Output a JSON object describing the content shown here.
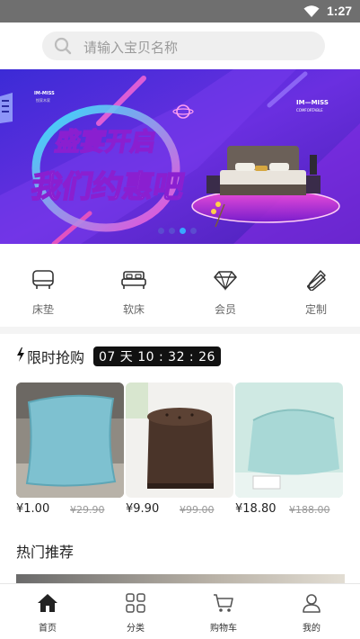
{
  "status_bar": {
    "time": "1:27",
    "icons": [
      "wifi-icon",
      "battery-icon"
    ]
  },
  "search": {
    "placeholder": "请输入宝贝名称",
    "icon": "search-icon"
  },
  "banner": {
    "headline_1": "盛宴开启",
    "headline_2": "我们约惠吧",
    "brand_left": "IM-MISS",
    "brand_left_sub": "悦家木家",
    "brand_right": "IM—MISS",
    "brand_right_sub": "COMFORTABLE",
    "pager_count": 4,
    "pager_active": 2
  },
  "categories": [
    {
      "label": "床垫",
      "icon": "mattress-icon"
    },
    {
      "label": "软床",
      "icon": "bed-icon"
    },
    {
      "label": "会员",
      "icon": "diamond-icon"
    },
    {
      "label": "定制",
      "icon": "pencil-ruler-icon"
    }
  ],
  "flash_sale": {
    "icon": "lightning-icon",
    "title": "限时抢购",
    "countdown": "07 天 10 : 32 : 26"
  },
  "products": [
    {
      "price": "¥1.00",
      "old_price": "¥29.90",
      "image": "cushion"
    },
    {
      "price": "¥9.90",
      "old_price": "¥99.00",
      "image": "leather-ottoman"
    },
    {
      "price": "¥18.80",
      "old_price": "¥188.00",
      "image": "memory-foam-pillow"
    }
  ],
  "hot": {
    "title": "热门推荐"
  },
  "tabs": [
    {
      "label": "首页",
      "icon": "home-icon",
      "active": true
    },
    {
      "label": "分类",
      "icon": "grid-icon",
      "active": false
    },
    {
      "label": "购物车",
      "icon": "cart-icon",
      "active": false
    },
    {
      "label": "我的",
      "icon": "user-icon",
      "active": false
    }
  ]
}
